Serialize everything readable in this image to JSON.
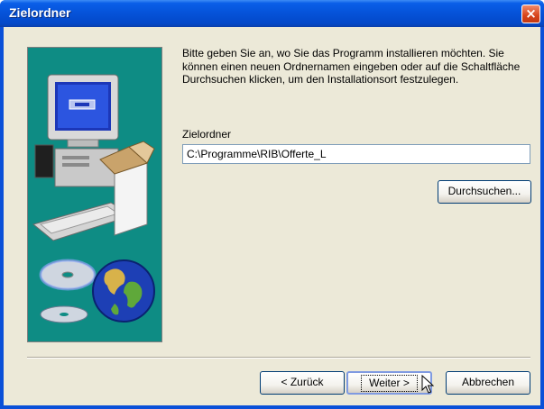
{
  "window": {
    "title": "Zielordner",
    "close_label": "×"
  },
  "description": "Bitte geben Sie an, wo Sie das Programm installieren möchten. Sie können einen neuen Ordnernamen eingeben oder auf die Schaltfläche Durchsuchen klicken, um den Installationsort festzulegen.",
  "target": {
    "label": "Zielordner",
    "path": "C:\\Programme\\RIB\\Offerte_L"
  },
  "buttons": {
    "browse": "Durchsuchen...",
    "back": "< Zurück",
    "next": "Weiter >",
    "cancel": "Abbrechen"
  },
  "colors": {
    "titlebar": "#0552d8",
    "panel": "#0e8c84",
    "dialog_bg": "#ece9d8"
  },
  "icons": {
    "illustration": [
      "computer-icon",
      "box-icon",
      "cd-icon",
      "globe-icon"
    ],
    "pointer": "mouse-cursor-icon"
  }
}
